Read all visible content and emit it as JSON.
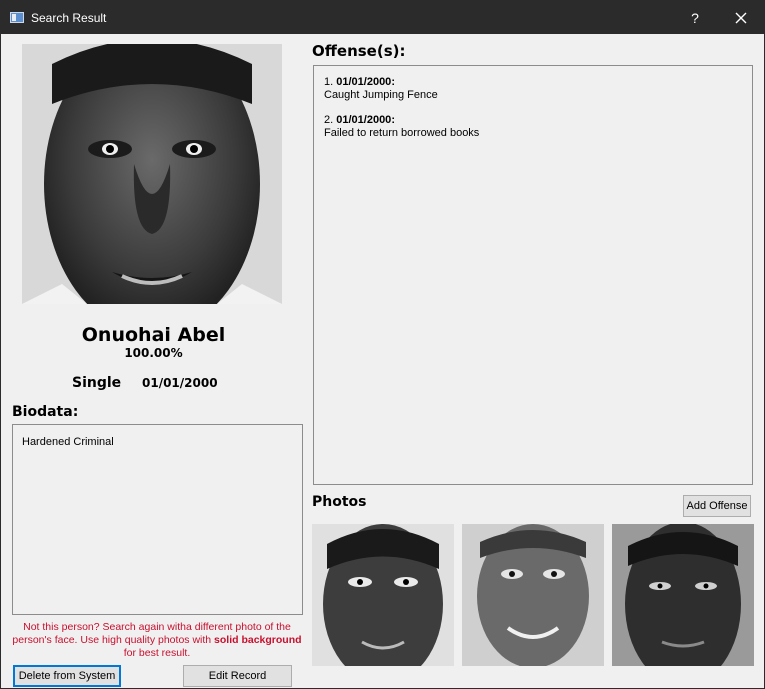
{
  "window": {
    "title": "Search Result",
    "help_label": "?",
    "icons": {
      "app": "app-icon",
      "close": "close-icon"
    }
  },
  "profile": {
    "name": "Onuohai Abel",
    "match": "100.00%",
    "status": "Single",
    "dob": "01/01/2000"
  },
  "biodata": {
    "heading": "Biodata:",
    "text": "Hardened Criminal"
  },
  "offenses": {
    "heading": "Offense(s):",
    "items": [
      {
        "num": "1.",
        "date": "01/01/2000",
        "desc": "Caught Jumping Fence"
      },
      {
        "num": "2.",
        "date": "01/01/2000",
        "desc": "Failed to return borrowed books"
      }
    ]
  },
  "photos": {
    "heading": "Photos",
    "add_offense_label": "Add Offense"
  },
  "hint": {
    "part1": "Not this person? Search again witha different photo of the person's face. Use high quality photos with ",
    "bold1": "solid background",
    "part2": " for best result."
  },
  "buttons": {
    "delete_label": "Delete from System",
    "edit_label": "Edit Record"
  },
  "colors": {
    "titlebar": "#2b2b2b",
    "window_bg": "#f0f0f0",
    "hint_red": "#c8102e",
    "focus_blue": "#0078d7"
  }
}
